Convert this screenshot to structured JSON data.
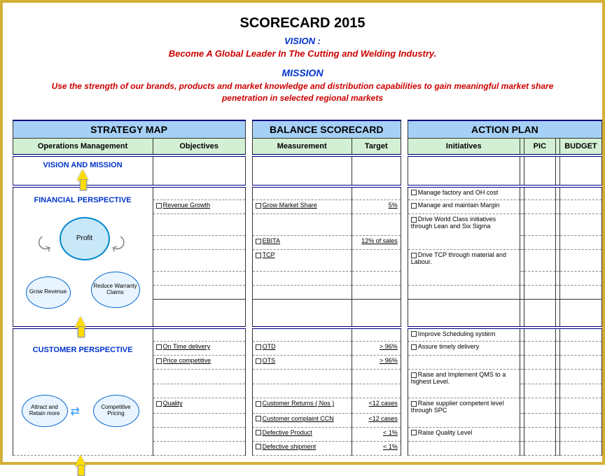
{
  "header": {
    "title": "SCORECARD 2015",
    "vision_label": "VISION :",
    "vision_text": "Become A Global Leader In The Cutting and Welding Industry.",
    "mission_label": "MISSION",
    "mission_text": "Use the strength of our brands, products and market knowledge and distribution capabilities to gain meaningful market share penetration in selected regional markets"
  },
  "sections": {
    "strategy": "STRATEGY MAP",
    "balance": "BALANCE SCORECARD",
    "action": "ACTION  PLAN"
  },
  "columns": {
    "ops": "Operations Management",
    "obj": "Objectives",
    "meas": "Measurement",
    "target": "Target",
    "init": "Initiatives",
    "pic": "PIC",
    "budget": "BUDGET"
  },
  "perspectives": {
    "vision": "VISION AND MISSION",
    "financial": "FINANCIAL  PERSPECTIVE",
    "customer": "CUSTOMER PERSPECTIVE"
  },
  "diagram": {
    "profit": "Profit",
    "grow_rev": "Grow Revenue",
    "reduce_war": "Reduce Warranty Claims",
    "attract": "Attract and Retain more",
    "comp_price": "Competitive Pricing"
  },
  "financial": {
    "obj": [
      "Revenue Growth"
    ],
    "meas": [
      "Grow Market Share",
      "EBITA",
      "TCP"
    ],
    "target": [
      "5%",
      "12% of sales",
      ""
    ],
    "init": [
      "Manage factory and OH cost",
      "Manage and maintain Margin",
      "Drive World Class initiatives through Lean and Six Sigma",
      "Drive TCP through material and Labour."
    ]
  },
  "customer": {
    "obj": [
      "On Time delivery",
      "Price competitive",
      "",
      "",
      "Quality"
    ],
    "meas": [
      "OTD",
      "OTS",
      "",
      "",
      "Customer Returns ( Nos )",
      "Customer complaint CCN",
      "Defective Product",
      "Defective shipment"
    ],
    "target": [
      "> 96%",
      "> 96%",
      "",
      "",
      "<12 cases",
      "<12 cases",
      "< 1%",
      "< 1%"
    ],
    "init": [
      "Improve Scheduling system",
      "Assure timely delivery",
      "",
      "Raise and Implement QMS to a highest Level.",
      "Raise supplier competent level through SPC",
      "",
      "Raise Quality Level"
    ]
  }
}
